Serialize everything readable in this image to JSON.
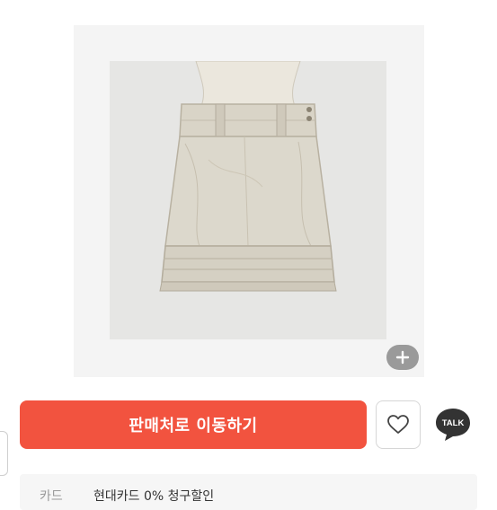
{
  "product": {
    "image_alt": "",
    "zoom_icon": "plus-icon"
  },
  "actions": {
    "cta_label": "판매처로 이동하기",
    "wish_icon": "heart-icon",
    "talk_label": "TALK"
  },
  "benefit": {
    "label": "카드",
    "text": "현대카드 0% 청구할인"
  },
  "colors": {
    "cta": "#f2533f",
    "talk_bg": "#333333",
    "zoom_bg": "#9a9a9a"
  }
}
